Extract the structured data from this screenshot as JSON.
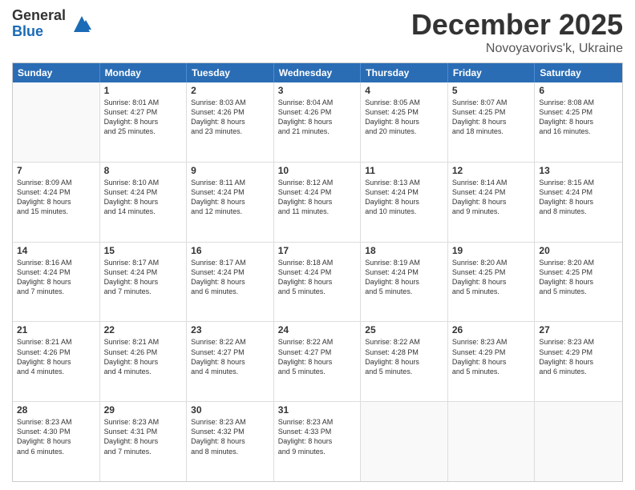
{
  "logo": {
    "general": "General",
    "blue": "Blue"
  },
  "title": "December 2025",
  "subtitle": "Novoyavorivs'k, Ukraine",
  "header_days": [
    "Sunday",
    "Monday",
    "Tuesday",
    "Wednesday",
    "Thursday",
    "Friday",
    "Saturday"
  ],
  "weeks": [
    [
      {
        "day": "",
        "empty": true
      },
      {
        "day": "1",
        "lines": [
          "Sunrise: 8:01 AM",
          "Sunset: 4:27 PM",
          "Daylight: 8 hours",
          "and 25 minutes."
        ]
      },
      {
        "day": "2",
        "lines": [
          "Sunrise: 8:03 AM",
          "Sunset: 4:26 PM",
          "Daylight: 8 hours",
          "and 23 minutes."
        ]
      },
      {
        "day": "3",
        "lines": [
          "Sunrise: 8:04 AM",
          "Sunset: 4:26 PM",
          "Daylight: 8 hours",
          "and 21 minutes."
        ]
      },
      {
        "day": "4",
        "lines": [
          "Sunrise: 8:05 AM",
          "Sunset: 4:25 PM",
          "Daylight: 8 hours",
          "and 20 minutes."
        ]
      },
      {
        "day": "5",
        "lines": [
          "Sunrise: 8:07 AM",
          "Sunset: 4:25 PM",
          "Daylight: 8 hours",
          "and 18 minutes."
        ]
      },
      {
        "day": "6",
        "lines": [
          "Sunrise: 8:08 AM",
          "Sunset: 4:25 PM",
          "Daylight: 8 hours",
          "and 16 minutes."
        ]
      }
    ],
    [
      {
        "day": "7",
        "lines": [
          "Sunrise: 8:09 AM",
          "Sunset: 4:24 PM",
          "Daylight: 8 hours",
          "and 15 minutes."
        ]
      },
      {
        "day": "8",
        "lines": [
          "Sunrise: 8:10 AM",
          "Sunset: 4:24 PM",
          "Daylight: 8 hours",
          "and 14 minutes."
        ]
      },
      {
        "day": "9",
        "lines": [
          "Sunrise: 8:11 AM",
          "Sunset: 4:24 PM",
          "Daylight: 8 hours",
          "and 12 minutes."
        ]
      },
      {
        "day": "10",
        "lines": [
          "Sunrise: 8:12 AM",
          "Sunset: 4:24 PM",
          "Daylight: 8 hours",
          "and 11 minutes."
        ]
      },
      {
        "day": "11",
        "lines": [
          "Sunrise: 8:13 AM",
          "Sunset: 4:24 PM",
          "Daylight: 8 hours",
          "and 10 minutes."
        ]
      },
      {
        "day": "12",
        "lines": [
          "Sunrise: 8:14 AM",
          "Sunset: 4:24 PM",
          "Daylight: 8 hours",
          "and 9 minutes."
        ]
      },
      {
        "day": "13",
        "lines": [
          "Sunrise: 8:15 AM",
          "Sunset: 4:24 PM",
          "Daylight: 8 hours",
          "and 8 minutes."
        ]
      }
    ],
    [
      {
        "day": "14",
        "lines": [
          "Sunrise: 8:16 AM",
          "Sunset: 4:24 PM",
          "Daylight: 8 hours",
          "and 7 minutes."
        ]
      },
      {
        "day": "15",
        "lines": [
          "Sunrise: 8:17 AM",
          "Sunset: 4:24 PM",
          "Daylight: 8 hours",
          "and 7 minutes."
        ]
      },
      {
        "day": "16",
        "lines": [
          "Sunrise: 8:17 AM",
          "Sunset: 4:24 PM",
          "Daylight: 8 hours",
          "and 6 minutes."
        ]
      },
      {
        "day": "17",
        "lines": [
          "Sunrise: 8:18 AM",
          "Sunset: 4:24 PM",
          "Daylight: 8 hours",
          "and 5 minutes."
        ]
      },
      {
        "day": "18",
        "lines": [
          "Sunrise: 8:19 AM",
          "Sunset: 4:24 PM",
          "Daylight: 8 hours",
          "and 5 minutes."
        ]
      },
      {
        "day": "19",
        "lines": [
          "Sunrise: 8:20 AM",
          "Sunset: 4:25 PM",
          "Daylight: 8 hours",
          "and 5 minutes."
        ]
      },
      {
        "day": "20",
        "lines": [
          "Sunrise: 8:20 AM",
          "Sunset: 4:25 PM",
          "Daylight: 8 hours",
          "and 5 minutes."
        ]
      }
    ],
    [
      {
        "day": "21",
        "lines": [
          "Sunrise: 8:21 AM",
          "Sunset: 4:26 PM",
          "Daylight: 8 hours",
          "and 4 minutes."
        ]
      },
      {
        "day": "22",
        "lines": [
          "Sunrise: 8:21 AM",
          "Sunset: 4:26 PM",
          "Daylight: 8 hours",
          "and 4 minutes."
        ]
      },
      {
        "day": "23",
        "lines": [
          "Sunrise: 8:22 AM",
          "Sunset: 4:27 PM",
          "Daylight: 8 hours",
          "and 4 minutes."
        ]
      },
      {
        "day": "24",
        "lines": [
          "Sunrise: 8:22 AM",
          "Sunset: 4:27 PM",
          "Daylight: 8 hours",
          "and 5 minutes."
        ]
      },
      {
        "day": "25",
        "lines": [
          "Sunrise: 8:22 AM",
          "Sunset: 4:28 PM",
          "Daylight: 8 hours",
          "and 5 minutes."
        ]
      },
      {
        "day": "26",
        "lines": [
          "Sunrise: 8:23 AM",
          "Sunset: 4:29 PM",
          "Daylight: 8 hours",
          "and 5 minutes."
        ]
      },
      {
        "day": "27",
        "lines": [
          "Sunrise: 8:23 AM",
          "Sunset: 4:29 PM",
          "Daylight: 8 hours",
          "and 6 minutes."
        ]
      }
    ],
    [
      {
        "day": "28",
        "lines": [
          "Sunrise: 8:23 AM",
          "Sunset: 4:30 PM",
          "Daylight: 8 hours",
          "and 6 minutes."
        ]
      },
      {
        "day": "29",
        "lines": [
          "Sunrise: 8:23 AM",
          "Sunset: 4:31 PM",
          "Daylight: 8 hours",
          "and 7 minutes."
        ]
      },
      {
        "day": "30",
        "lines": [
          "Sunrise: 8:23 AM",
          "Sunset: 4:32 PM",
          "Daylight: 8 hours",
          "and 8 minutes."
        ]
      },
      {
        "day": "31",
        "lines": [
          "Sunrise: 8:23 AM",
          "Sunset: 4:33 PM",
          "Daylight: 8 hours",
          "and 9 minutes."
        ]
      },
      {
        "day": "",
        "empty": true
      },
      {
        "day": "",
        "empty": true
      },
      {
        "day": "",
        "empty": true
      }
    ]
  ]
}
